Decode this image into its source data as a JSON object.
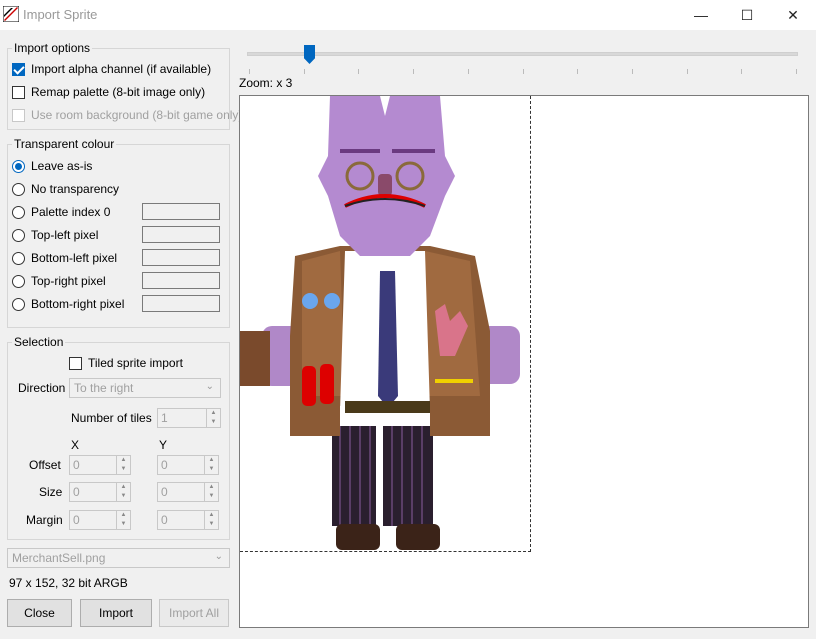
{
  "window": {
    "title": "Import Sprite"
  },
  "import_options": {
    "legend": "Import options",
    "alpha": {
      "label": "Import alpha channel (if available)",
      "checked": true
    },
    "remap": {
      "label": "Remap palette (8-bit image only)",
      "checked": false
    },
    "room_bg": {
      "label": "Use room background (8-bit game only)",
      "checked": false,
      "enabled": false
    }
  },
  "transparent": {
    "legend": "Transparent colour",
    "options": [
      {
        "label": "Leave as-is",
        "checked": true
      },
      {
        "label": "No transparency",
        "checked": false
      },
      {
        "label": "Palette index 0",
        "checked": false
      },
      {
        "label": "Top-left pixel",
        "checked": false
      },
      {
        "label": "Bottom-left pixel",
        "checked": false
      },
      {
        "label": "Top-right pixel",
        "checked": false
      },
      {
        "label": "Bottom-right pixel",
        "checked": false
      }
    ]
  },
  "selection": {
    "legend": "Selection",
    "tiled_label": "Tiled sprite import",
    "direction_label": "Direction",
    "direction_value": "To the right",
    "tiles_label": "Number of tiles",
    "tiles_value": "1",
    "col_x": "X",
    "col_y": "Y",
    "offset_label": "Offset",
    "size_label": "Size",
    "margin_label": "Margin",
    "offset_x": "0",
    "offset_y": "0",
    "size_x": "0",
    "size_y": "0",
    "margin_x": "0",
    "margin_y": "0"
  },
  "file": {
    "name": "MerchantSell.png",
    "info": "97 x 152, 32 bit ARGB"
  },
  "buttons": {
    "close": "Close",
    "import": "Import",
    "import_all": "Import All"
  },
  "zoom": {
    "label": "Zoom: x 3"
  }
}
